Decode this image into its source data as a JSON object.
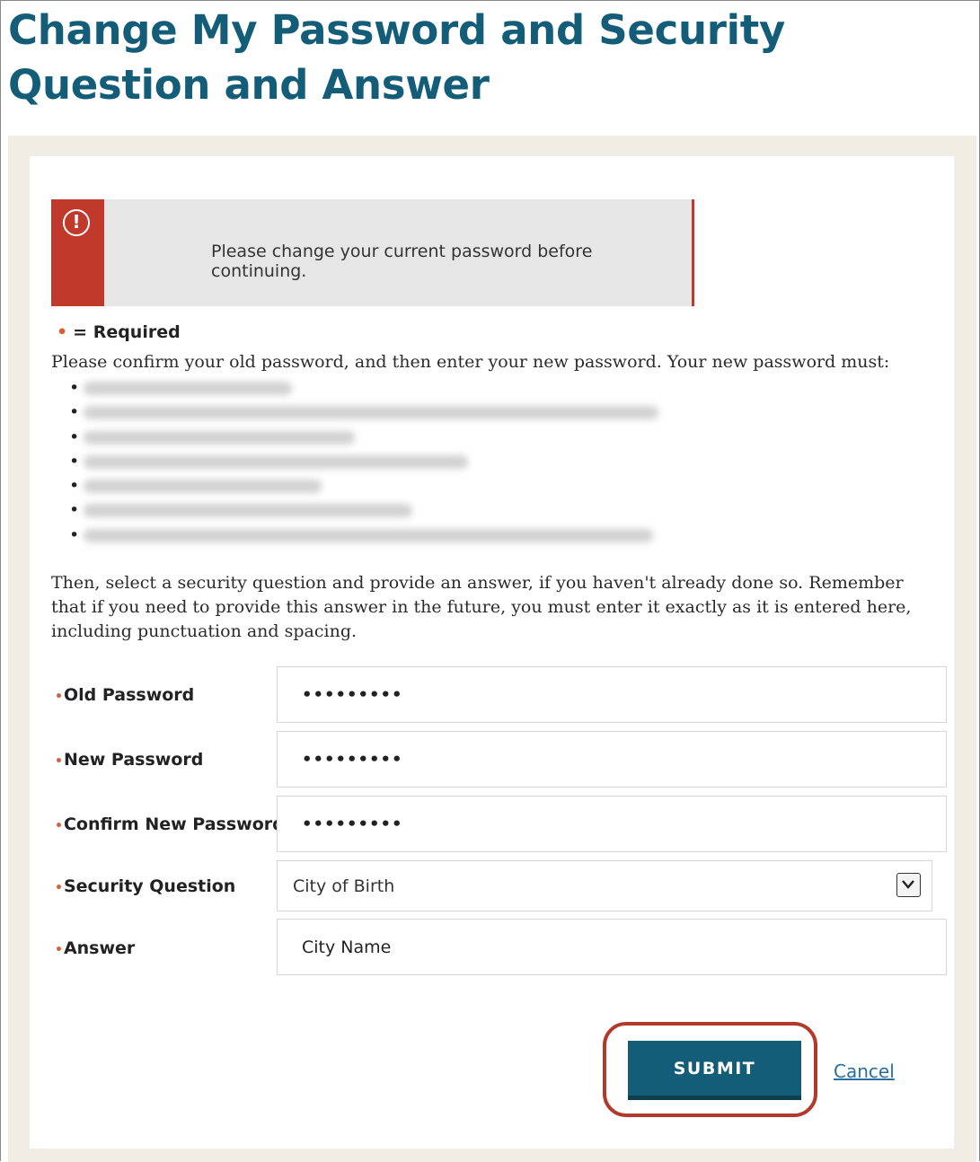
{
  "page": {
    "title": "Change My Password and Security Question and Answer"
  },
  "alert": {
    "icon": "exclamation-circle-icon",
    "message": "Please change your current password before continuing."
  },
  "required_note": {
    "marker": "•",
    "text": "= Required"
  },
  "instructions": {
    "intro": "Please confirm your old password, and then enter your new password. Your new password must:",
    "rules_count_note": "7 password rules (text blurred/redacted)",
    "paragraph": "Then, select a security question and provide an answer, if you haven't already done so. Remember that if you need to provide this answer in the future, you must enter it exactly as it is entered here, including punctuation and spacing."
  },
  "form": {
    "old_password": {
      "label": "Old Password",
      "value": "•••••••••"
    },
    "new_password": {
      "label": "New Password",
      "value": "•••••••••"
    },
    "confirm_password": {
      "label": "Confirm New Password",
      "value": "•••••••••"
    },
    "security_question": {
      "label": "Security Question",
      "selected": "City of Birth"
    },
    "answer": {
      "label": "Answer",
      "value": "City Name"
    }
  },
  "actions": {
    "submit_label": "SUBMIT",
    "cancel_label": "Cancel"
  },
  "colors": {
    "title": "#135d78",
    "alert_accent": "#c0392b",
    "submit_bg": "#135d78",
    "highlight_ring": "#b23a2a",
    "link": "#2a6fa0"
  }
}
